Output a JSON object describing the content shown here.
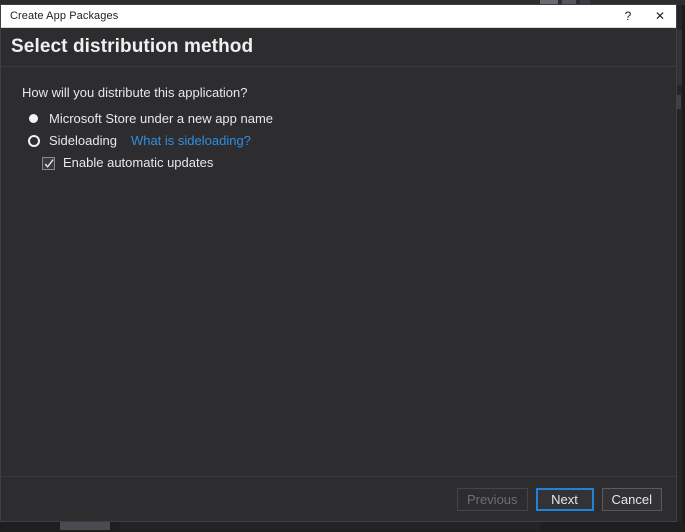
{
  "window": {
    "title": "Create App Packages",
    "help_icon": "question-mark-icon",
    "help_label": "?",
    "close_icon": "close-icon",
    "close_label": "✕"
  },
  "header": {
    "title": "Select distribution method"
  },
  "content": {
    "question": "How will you distribute this application?",
    "options": [
      {
        "id": "microsoft-store",
        "label": "Microsoft Store under a new app name",
        "state": "filled"
      },
      {
        "id": "sideloading",
        "label": "Sideloading",
        "state": "ring",
        "link_label": "What is sideloading?"
      }
    ],
    "suboption": {
      "id": "enable-automatic-updates",
      "label": "Enable automatic updates",
      "checked": true,
      "check_icon": "checkmark-icon"
    }
  },
  "footer": {
    "previous_label": "Previous",
    "previous_disabled": true,
    "next_label": "Next",
    "next_is_default": true,
    "cancel_label": "Cancel"
  },
  "colors": {
    "dialog_bg": "#2d2d30",
    "titlebar_bg": "#ffffff",
    "text": "#e8e8e8",
    "link": "#2f8ee0",
    "focus_accent": "#1f84d8",
    "disabled_text": "#6e6e72"
  }
}
